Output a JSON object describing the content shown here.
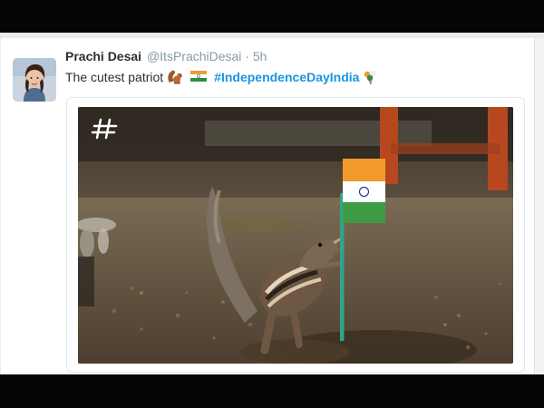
{
  "tweet": {
    "name": "Prachi Desai",
    "handle": "@ItsPrachiDesai",
    "separator": "·",
    "time": "5h",
    "text_lead": "The cutest patriot",
    "hashtag": "#IndependenceDayIndia",
    "emojis": [
      "squirrel-emoji",
      "india-flag-emoji",
      "tricolor-balloon-emoji"
    ]
  },
  "photo": {
    "subject": "squirrel holding Indian flag",
    "watermark_icon": "hash-icon",
    "flag_colors": {
      "saffron": "#f39a2d",
      "white": "#ffffff",
      "green": "#3e9c44",
      "chakra": "#233f8f"
    }
  },
  "colors": {
    "name": "#292f33",
    "meta": "#8899a6",
    "hashtag": "#1b95e0",
    "card_border": "#e1e8ed"
  }
}
